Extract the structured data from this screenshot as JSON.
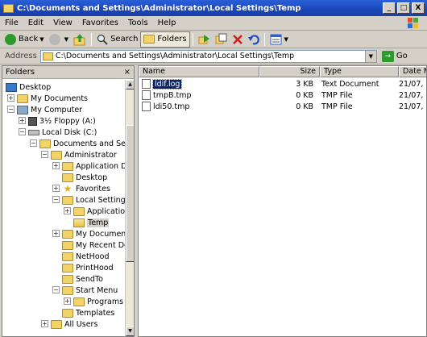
{
  "window": {
    "title": "C:\\Documents and Settings\\Administrator\\Local Settings\\Temp",
    "minimize": "_",
    "maximize": "□",
    "close": "X"
  },
  "menu": [
    "File",
    "Edit",
    "View",
    "Favorites",
    "Tools",
    "Help"
  ],
  "toolbar": {
    "back": "Back",
    "search": "Search",
    "folders": "Folders"
  },
  "address": {
    "label": "Address",
    "value": "C:\\Documents and Settings\\Administrator\\Local Settings\\Temp",
    "go": "Go"
  },
  "folders_pane": {
    "title": "Folders",
    "close": "×",
    "items": [
      {
        "label": "Desktop",
        "icon": "desktop-icon",
        "expander": ""
      },
      {
        "label": "My Documents",
        "icon": "folder-icon",
        "expander": "+"
      },
      {
        "label": "My Computer",
        "icon": "computer-icon",
        "expander": "−"
      },
      {
        "label": "3½ Floppy (A:)",
        "icon": "floppy-icon",
        "expander": "+"
      },
      {
        "label": "Local Disk (C:)",
        "icon": "disk-icon",
        "expander": "−"
      },
      {
        "label": "Documents and Settin",
        "icon": "folder-icon",
        "expander": "−"
      },
      {
        "label": "Administrator",
        "icon": "folder-icon",
        "expander": "−"
      },
      {
        "label": "Application Da",
        "icon": "folder-icon",
        "expander": "+"
      },
      {
        "label": "Desktop",
        "icon": "folder-icon",
        "expander": ""
      },
      {
        "label": "Favorites",
        "icon": "favorites-icon",
        "expander": "+"
      },
      {
        "label": "Local Settings",
        "icon": "folder-icon",
        "expander": "−"
      },
      {
        "label": "Applicatio",
        "icon": "folder-icon",
        "expander": "+"
      },
      {
        "label": "Temp",
        "icon": "folder-open-icon",
        "expander": ""
      },
      {
        "label": "My Documents",
        "icon": "folder-icon",
        "expander": "+"
      },
      {
        "label": "My Recent Do",
        "icon": "folder-icon",
        "expander": ""
      },
      {
        "label": "NetHood",
        "icon": "folder-icon",
        "expander": ""
      },
      {
        "label": "PrintHood",
        "icon": "folder-icon",
        "expander": ""
      },
      {
        "label": "SendTo",
        "icon": "folder-icon",
        "expander": ""
      },
      {
        "label": "Start Menu",
        "icon": "folder-icon",
        "expander": "−"
      },
      {
        "label": "Programs",
        "icon": "folder-icon",
        "expander": "+"
      },
      {
        "label": "Templates",
        "icon": "folder-icon",
        "expander": ""
      },
      {
        "label": "All Users",
        "icon": "folder-icon",
        "expander": "+"
      }
    ],
    "selected_index": 12
  },
  "files_pane": {
    "columns": [
      "Name",
      "Size",
      "Type",
      "Date M"
    ],
    "rows": [
      {
        "name": "ldif.log",
        "size": "3 KB",
        "type": "Text Document",
        "date": "21/07,"
      },
      {
        "name": "tmpB.tmp",
        "size": "0 KB",
        "type": "TMP File",
        "date": "21/07,"
      },
      {
        "name": "ldi50.tmp",
        "size": "0 KB",
        "type": "TMP File",
        "date": "21/07,"
      }
    ],
    "selected_row": 0
  },
  "colors": {
    "titlebar": "#1b46b8",
    "selection": "#0a246a",
    "chrome": "#d4d0c8"
  }
}
